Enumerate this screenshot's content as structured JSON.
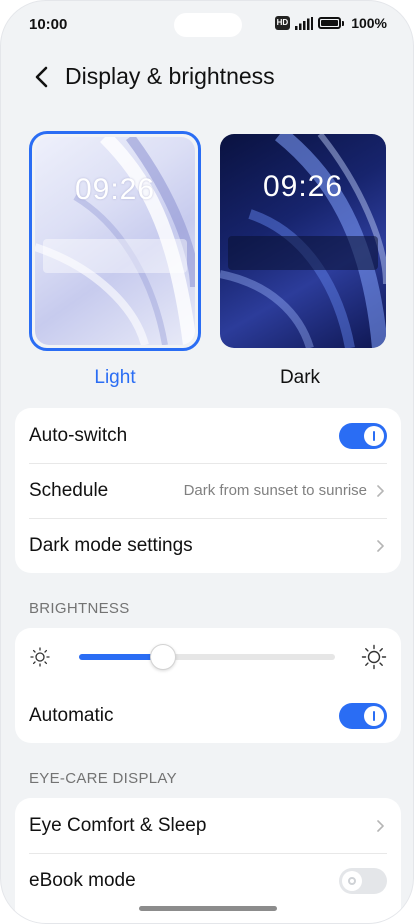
{
  "status_bar": {
    "time": "10:00",
    "hd_badge": "HD",
    "battery_percent": "100%"
  },
  "header": {
    "title": "Display & brightness"
  },
  "themes": {
    "light": {
      "label": "Light",
      "clock": "09:26",
      "selected": true
    },
    "dark": {
      "label": "Dark",
      "clock": "09:26",
      "selected": false
    }
  },
  "dark_mode_card": {
    "auto_switch": {
      "label": "Auto-switch",
      "on": true
    },
    "schedule": {
      "label": "Schedule",
      "value": "Dark from sunset to sunrise"
    },
    "dark_mode_settings": {
      "label": "Dark mode settings"
    }
  },
  "brightness": {
    "section_title": "BRIGHTNESS",
    "level": 0.33,
    "automatic": {
      "label": "Automatic",
      "on": true
    }
  },
  "eye_care": {
    "section_title": "EYE-CARE DISPLAY",
    "eye_comfort": {
      "label": "Eye Comfort & Sleep"
    },
    "ebook_mode": {
      "label": "eBook mode",
      "on": false
    }
  },
  "colors": {
    "accent": "#2a6df4",
    "background": "#f1f3f5",
    "card": "#ffffff"
  },
  "icons": {
    "back": "back-arrow-icon",
    "chevron": "chevron-right-icon",
    "brightness_low": "sun-small-icon",
    "brightness_high": "sun-large-icon",
    "signal": "signal-icon",
    "battery": "battery-icon"
  }
}
